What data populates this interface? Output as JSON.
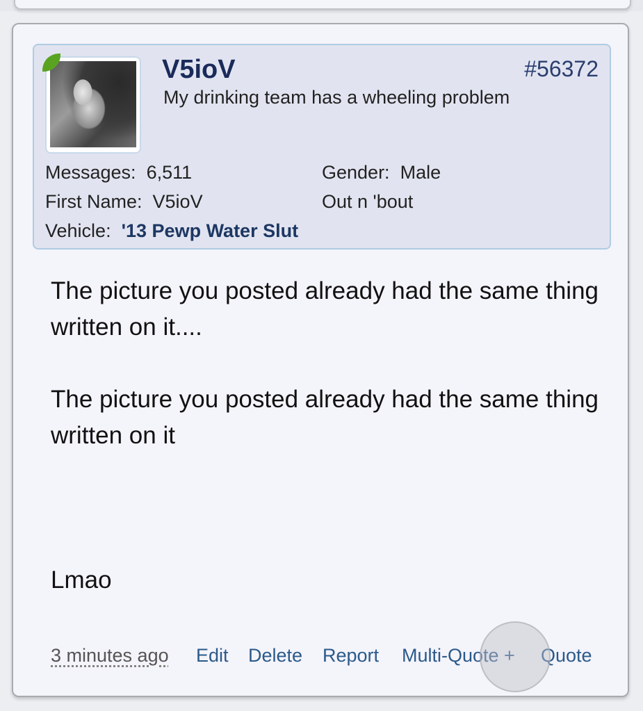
{
  "post": {
    "username": "V5ioV",
    "post_number": "#56372",
    "user_title": "My drinking team has a wheeling problem",
    "stats": {
      "messages_label": "Messages:",
      "messages_value": "6,511",
      "first_name_label": "First Name:",
      "first_name_value": "V5ioV",
      "vehicle_label": "Vehicle:",
      "vehicle_value": "'13 Pewp Water Slut",
      "gender_label": "Gender:",
      "gender_value": "Male",
      "location": "Out n 'bout"
    },
    "message": {
      "para1": "The picture you posted already had the same thing written on it....",
      "para2": "The picture you posted already had the same thing written on it",
      "para3": "Lmao"
    },
    "actions": {
      "timestamp": "3 minutes ago",
      "edit": "Edit",
      "delete": "Delete",
      "report": "Report",
      "multi_quote": "Multi-Quote +",
      "quote": "Quote"
    }
  },
  "colors": {
    "username": "#1a2a5a",
    "link": "#2b5a8a",
    "online_badge": "#5aa321",
    "user_box_bg": "#e1e4f0",
    "card_bg": "#f4f4fb"
  },
  "icons": {
    "online_badge": "online-status-icon"
  }
}
